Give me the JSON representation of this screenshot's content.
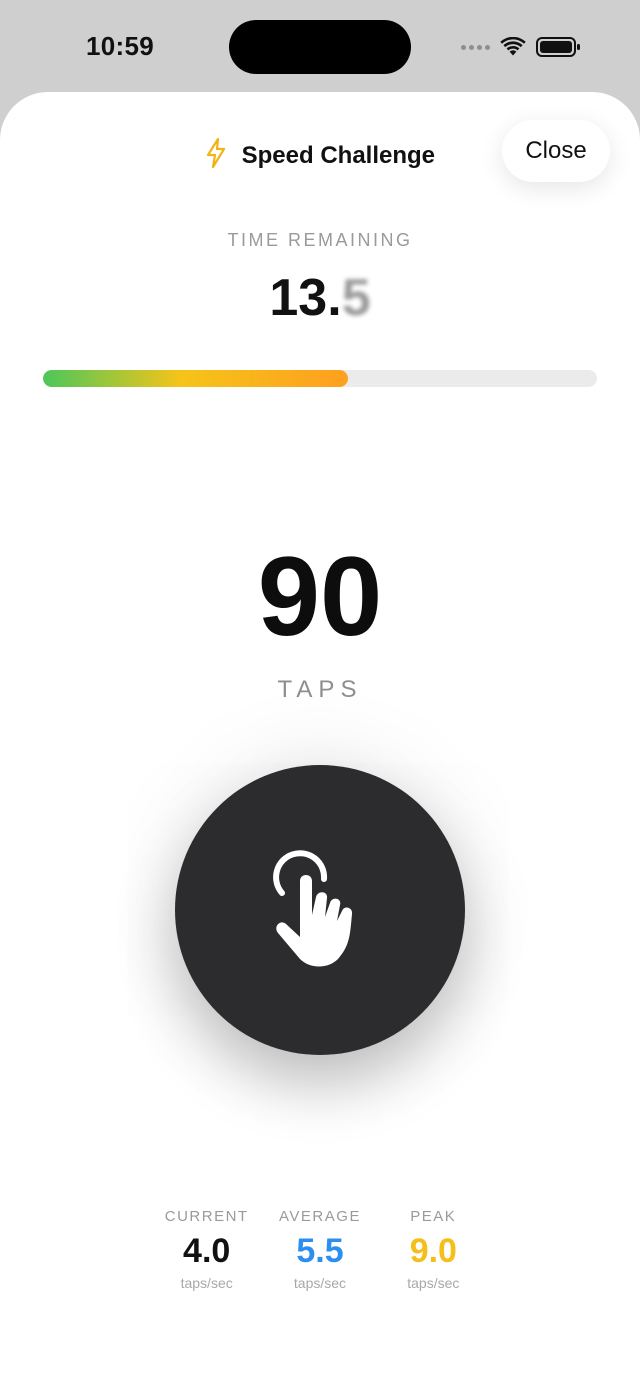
{
  "status_bar": {
    "time": "10:59"
  },
  "header": {
    "icon": "bolt-icon",
    "title": "Speed Challenge",
    "close_label": "Close"
  },
  "timer": {
    "label": "TIME REMAINING",
    "value_main": "13.",
    "value_fraction": "5",
    "progress_fraction": 0.55
  },
  "counter": {
    "value": "90",
    "label": "TAPS"
  },
  "tap_button": {
    "icon": "tap-hand-icon"
  },
  "stats": [
    {
      "label": "CURRENT",
      "value": "4.0",
      "unit": "taps/sec",
      "color": "#111111"
    },
    {
      "label": "AVERAGE",
      "value": "5.5",
      "unit": "taps/sec",
      "color": "#2b8ff0"
    },
    {
      "label": "PEAK",
      "value": "9.0",
      "unit": "taps/sec",
      "color": "#f5bf1a"
    }
  ],
  "colors": {
    "progress_start": "#4cc75a",
    "progress_mid": "#f5c419",
    "progress_end": "#ff9f1f",
    "button_bg": "#2c2c2e"
  }
}
